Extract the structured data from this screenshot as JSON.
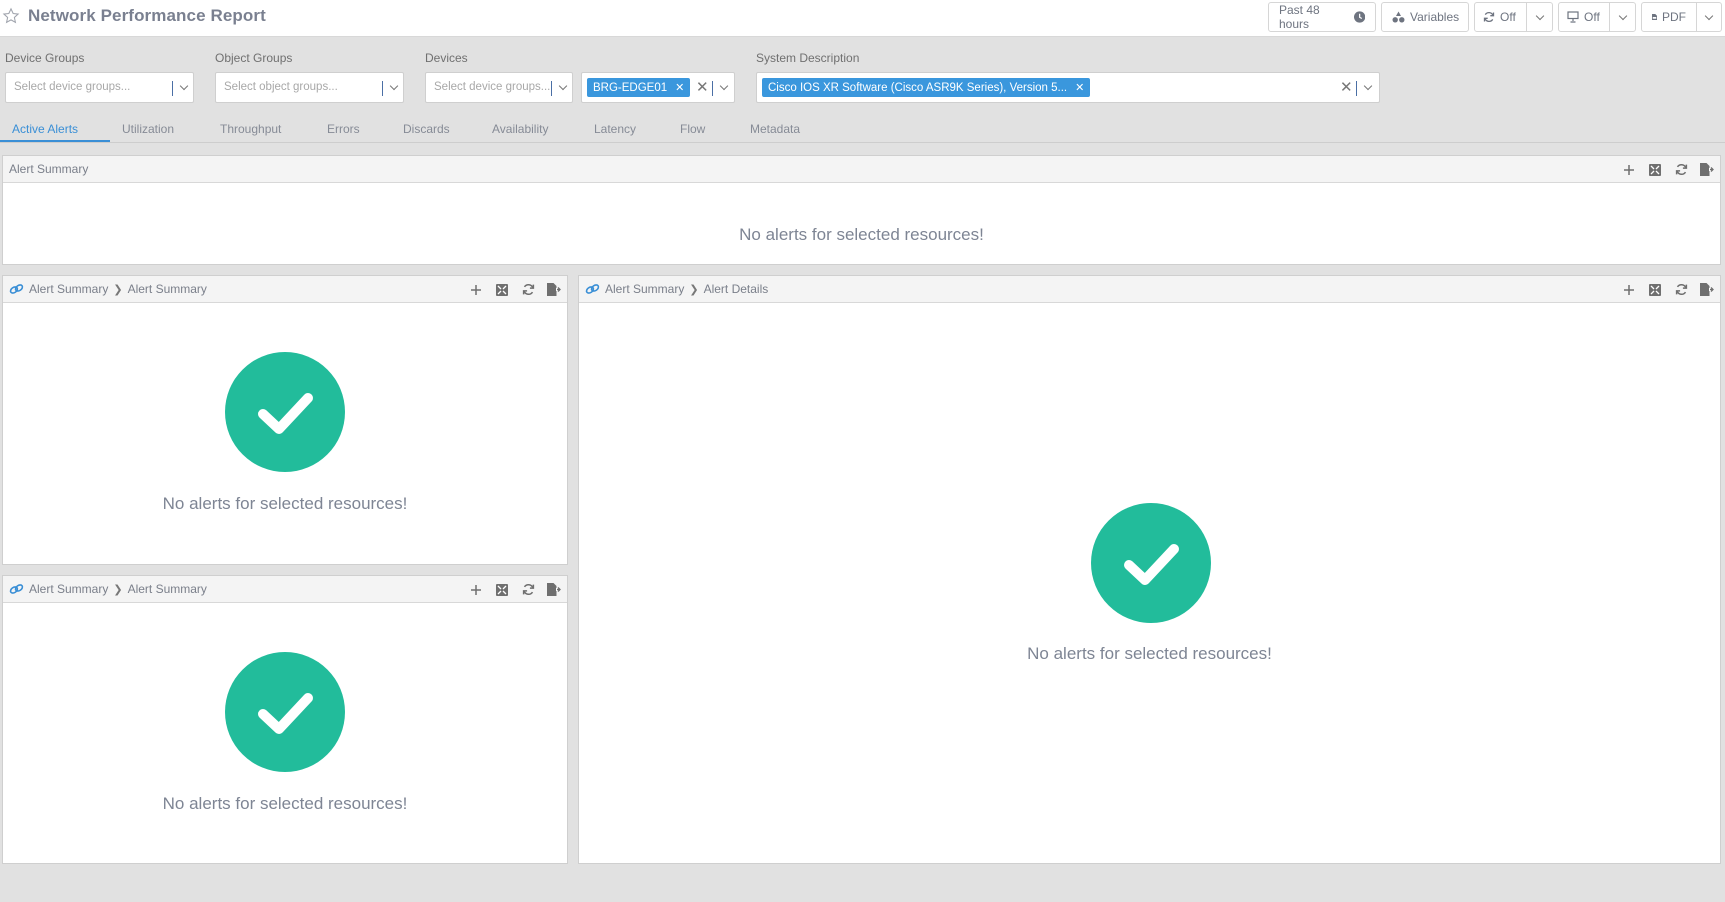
{
  "header": {
    "title": "Network Performance Report",
    "buttons": {
      "time_range": "Past 48 hours",
      "variables": "Variables",
      "refresh": "Off",
      "display": "Off",
      "export": "PDF"
    }
  },
  "filters": {
    "device_groups": {
      "label": "Device Groups",
      "placeholder": "Select device groups..."
    },
    "object_groups": {
      "label": "Object Groups",
      "placeholder": "Select object groups..."
    },
    "devices": {
      "label": "Devices",
      "placeholder": "Select device groups...",
      "selected": "BRG-EDGE01"
    },
    "system_description": {
      "label": "System Description",
      "selected": "Cisco IOS XR Software (Cisco ASR9K Series), Version 5..."
    }
  },
  "tabs": [
    {
      "label": "Active Alerts",
      "active": true
    },
    {
      "label": "Utilization"
    },
    {
      "label": "Throughput"
    },
    {
      "label": "Errors"
    },
    {
      "label": "Discards"
    },
    {
      "label": "Availability"
    },
    {
      "label": "Latency"
    },
    {
      "label": "Flow"
    },
    {
      "label": "Metadata"
    }
  ],
  "panels": {
    "top": {
      "title": "Alert Summary",
      "message": "No alerts for selected resources!"
    },
    "left_upper": {
      "crumb1": "Alert Summary",
      "crumb2": "Alert Summary",
      "message": "No alerts for selected resources!"
    },
    "left_lower": {
      "crumb1": "Alert Summary",
      "crumb2": "Alert Summary",
      "message": "No alerts for selected resources!"
    },
    "right": {
      "crumb1": "Alert Summary",
      "crumb2": "Alert Details",
      "message": "No alerts for selected resources!"
    }
  },
  "colors": {
    "accent": "#3a8fd6",
    "chip": "#3a97dd",
    "success": "#22bc9b"
  }
}
